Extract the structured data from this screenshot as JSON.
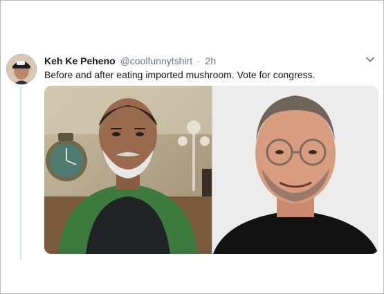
{
  "tweet": {
    "author_name": "Keh Ke Peheno",
    "handle": "@coolfunnytshirt",
    "separator": "·",
    "time": "2h",
    "text": "Before and after eating imported mushroom. Vote for congress."
  },
  "icons": {
    "menu": "chevron-down-icon"
  },
  "colors": {
    "name": "#14171a",
    "secondary": "#657786",
    "thread_line": "#cfe3ee"
  }
}
